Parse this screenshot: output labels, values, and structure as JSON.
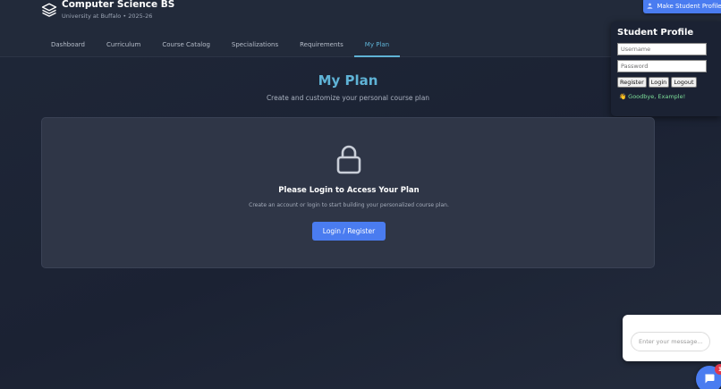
{
  "header": {
    "title": "Computer Science BS",
    "subtitle": "University at Buffalo • 2025-26",
    "logo_icon": "layers-icon"
  },
  "nav": {
    "tabs": [
      {
        "label": "Dashboard",
        "active": false
      },
      {
        "label": "Curriculum",
        "active": false
      },
      {
        "label": "Course Catalog",
        "active": false
      },
      {
        "label": "Specializations",
        "active": false
      },
      {
        "label": "Requirements",
        "active": false
      },
      {
        "label": "My Plan",
        "active": true
      }
    ]
  },
  "make_profile": {
    "label": "Make Student Profile",
    "icon": "user-icon"
  },
  "profile": {
    "title": "Student Profile",
    "username_placeholder": "Username",
    "password_placeholder": "Password",
    "register_label": "Register",
    "login_label": "Login",
    "logout_label": "Logout",
    "goodbye_icon": "👋",
    "goodbye_text": "Goodbye, Example!"
  },
  "main": {
    "title": "My Plan",
    "subtitle": "Create and customize your personal course plan",
    "card": {
      "icon": "lock-icon",
      "title": "Please Login to Access Your Plan",
      "text": "Create an account or login to start building your personalized course plan.",
      "button_label": "Login / Register"
    }
  },
  "chat": {
    "placeholder": "Enter your message...",
    "badge_count": "1",
    "icon": "chat-bubble-icon"
  },
  "colors": {
    "accent": "#5fb3d6",
    "primary_button": "#4a7cf0",
    "badge": "#e0384b",
    "success_text": "#7ddf9a"
  }
}
